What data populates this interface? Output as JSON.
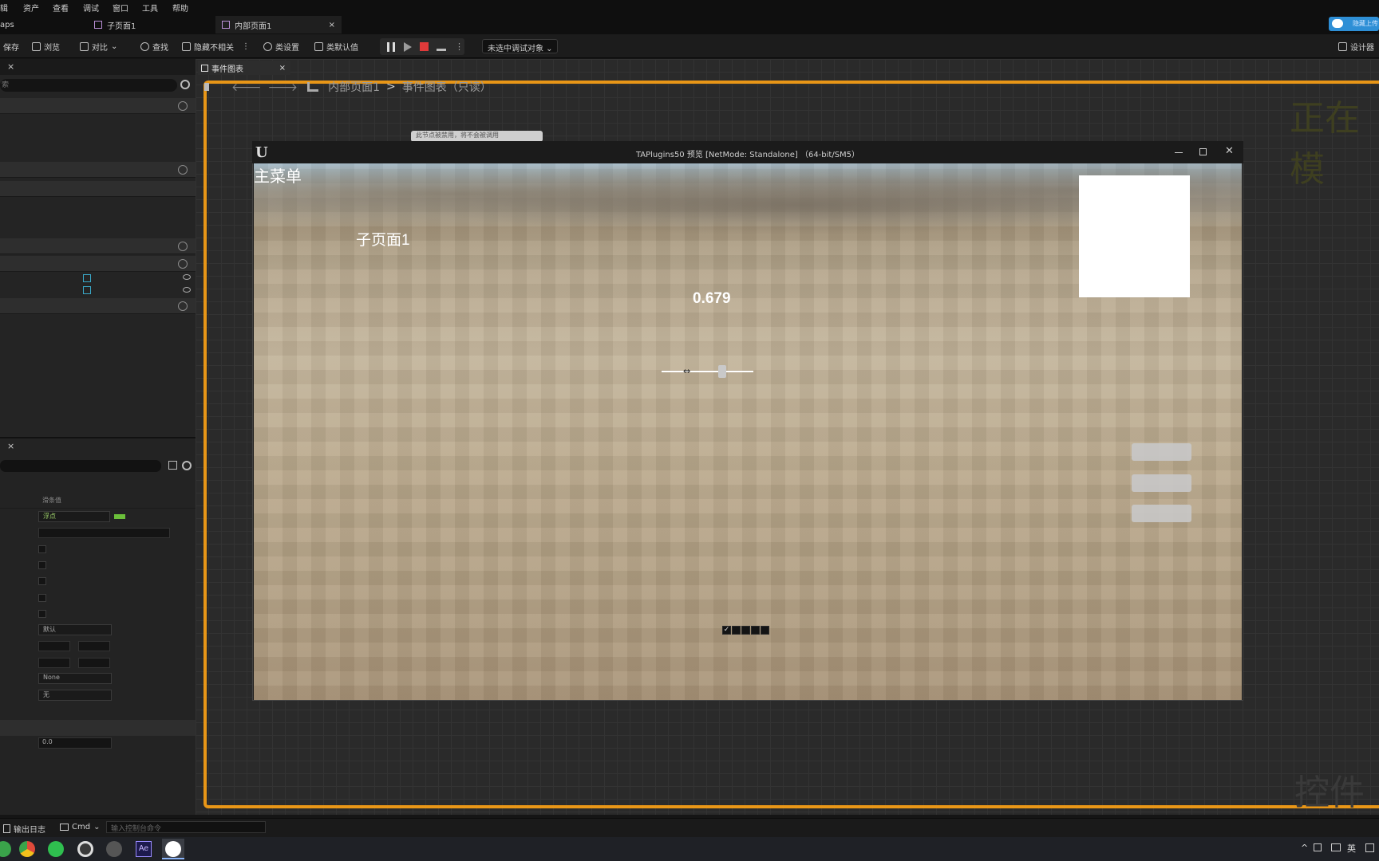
{
  "menu": [
    "辑",
    "资产",
    "查看",
    "调试",
    "窗口",
    "工具",
    "帮助"
  ],
  "doc_tabs": [
    {
      "label": "aps"
    },
    {
      "label": "子页面1"
    },
    {
      "label": "内部页面1",
      "close": "×"
    }
  ],
  "top_right_badge": "隐藏上传",
  "toolbar": {
    "save": "保存",
    "browse": "浏览",
    "diff": "对比",
    "find": "查找",
    "hide_unrelated": "隐藏不相关",
    "class_settings": "类设置",
    "class_defaults": "类默认值",
    "debug_object": "未选中调试对象",
    "designer": "设计器"
  },
  "graph": {
    "tab_label": "事件图表",
    "close": "×",
    "breadcrumb_root": "内部页面1",
    "breadcrumb_sep": ">",
    "breadcrumb_leaf": "事件图表（只读）",
    "watermark_top": "正在模",
    "watermark_bottom": "控件蓝",
    "comment_node": "此节点被禁用，将不会被调用"
  },
  "preview": {
    "title": "TAPlugins50 预览 [NetMode: Standalone] （64-bit/SM5）",
    "logo": "U",
    "main_menu": "主菜单",
    "sub_page": "子页面1",
    "value": "0.679",
    "slider_value": 0.679,
    "checkboxes": [
      true,
      false,
      false,
      false,
      false
    ]
  },
  "left_panel": {
    "close": "×",
    "search_placeholder": "索",
    "details_close": "×",
    "column_header": "滑条值",
    "float_type": "浮点",
    "default_dd": "默认",
    "none_dd": "None",
    "wu_dd": "无",
    "value_field": "0.0"
  },
  "statusbar": {
    "output_log": "输出日志",
    "cmd": "Cmd",
    "console_placeholder": "输入控制台命令"
  },
  "tray": {
    "lang": "英"
  },
  "colors": {
    "accent_orange": "#e89617",
    "stop_red": "#e03a3a"
  }
}
